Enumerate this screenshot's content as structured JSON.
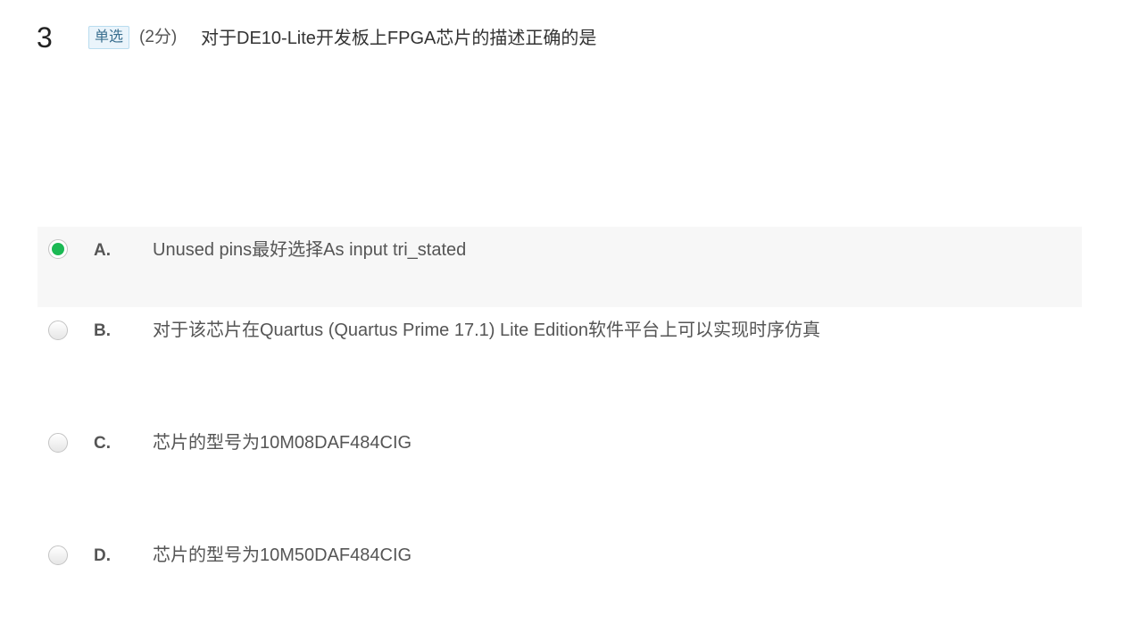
{
  "question": {
    "number": "3",
    "type_badge": "单选",
    "score": "(2分)",
    "stem": "对于DE10-Lite开发板上FPGA芯片的描述正确的是"
  },
  "options": [
    {
      "letter": "A.",
      "text": "Unused pins最好选择As input tri_stated",
      "selected": true
    },
    {
      "letter": "B.",
      "text": "对于该芯片在Quartus (Quartus Prime 17.1) Lite Edition软件平台上可以实现时序仿真",
      "selected": false
    },
    {
      "letter": "C.",
      "text": "芯片的型号为10M08DAF484CIG",
      "selected": false
    },
    {
      "letter": "D.",
      "text": "芯片的型号为10M50DAF484CIG",
      "selected": false
    }
  ],
  "colors": {
    "selected_radio": "#1bb954",
    "selected_row_bg": "#f7f7f7",
    "badge_bg": "#eaf4fb",
    "badge_border": "#b9dcef"
  }
}
